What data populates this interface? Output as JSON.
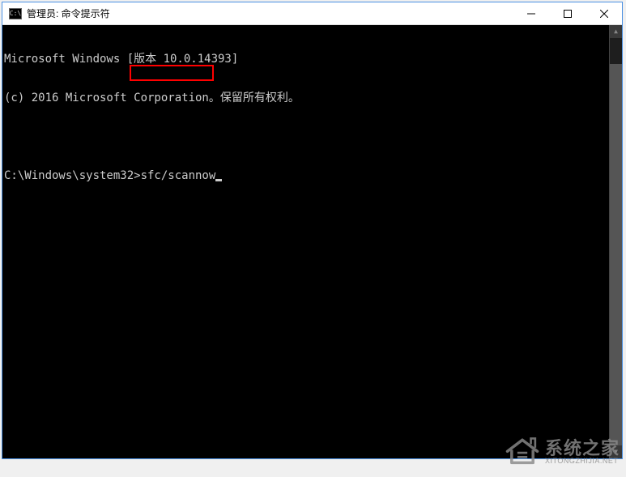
{
  "titlebar": {
    "icon_label": "C:\\",
    "title": "管理员: 命令提示符"
  },
  "terminal": {
    "line1": "Microsoft Windows [版本 10.0.14393]",
    "line2": "(c) 2016 Microsoft Corporation。保留所有权利。",
    "prompt": "C:\\Windows\\system32>",
    "command": "sfc/scannow"
  },
  "watermark": {
    "brand_cn": "系统之家",
    "brand_url": "XITONGZHIJIA.NET"
  }
}
